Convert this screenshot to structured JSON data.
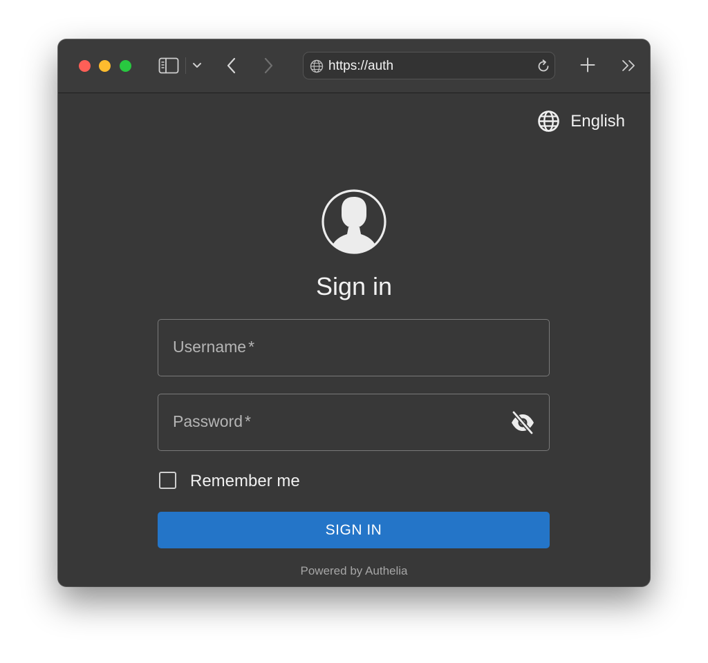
{
  "browser": {
    "url": "https://auth",
    "traffic_lights": {
      "close": "#ff5f57",
      "minimize": "#febc2e",
      "zoom": "#28c840"
    },
    "icons": [
      "sidebar-icon",
      "chevron-down-icon",
      "back-icon",
      "forward-icon",
      "globe-icon",
      "reload-icon",
      "new-tab-icon",
      "more-icon"
    ]
  },
  "page": {
    "language_label": "English",
    "title": "Sign in",
    "username": {
      "placeholder": "Username",
      "required_mark": "*",
      "value": ""
    },
    "password": {
      "placeholder": "Password",
      "required_mark": "*",
      "value": ""
    },
    "remember_label": "Remember me",
    "remember_checked": false,
    "signin_label": "SIGN IN",
    "footer": "Powered by Authelia",
    "accent_color": "#2475c8"
  }
}
